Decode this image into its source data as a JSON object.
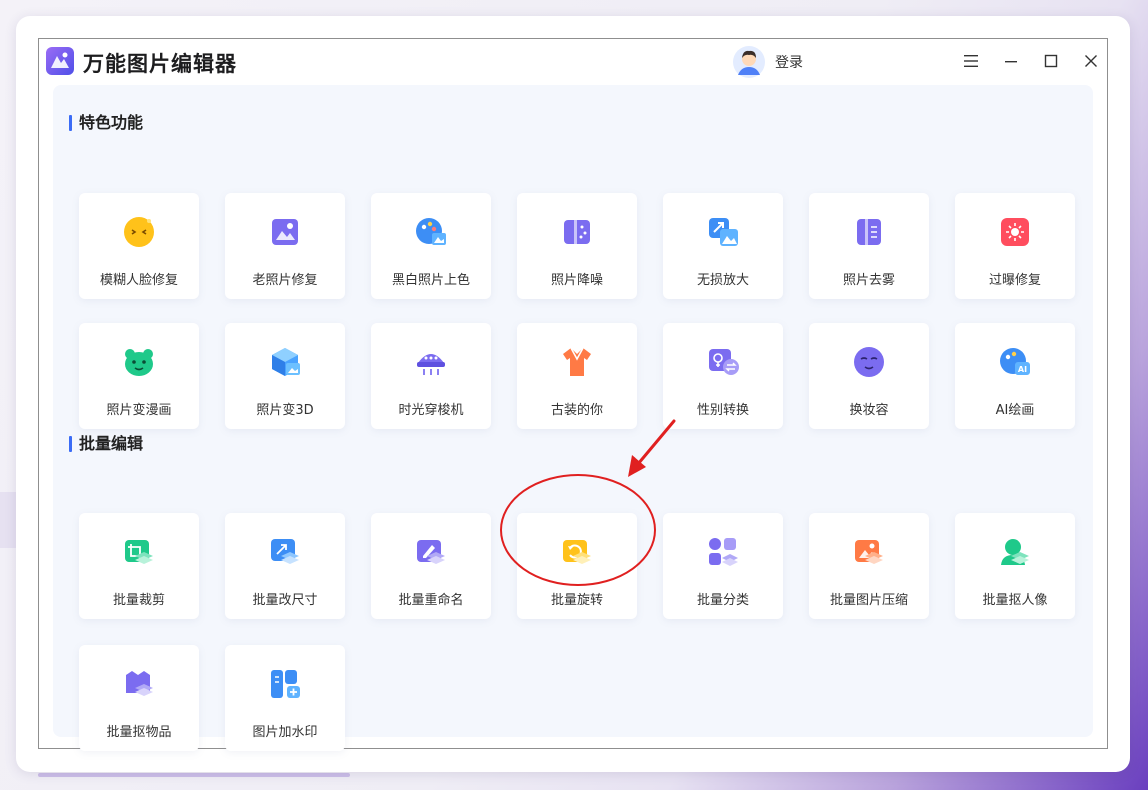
{
  "app": {
    "title": "万能图片编辑器",
    "login_label": "登录"
  },
  "sections": [
    {
      "title": "特色功能",
      "items": [
        {
          "label": "模糊人脸修复",
          "icon": "blur-face-icon"
        },
        {
          "label": "老照片修复",
          "icon": "old-photo-icon"
        },
        {
          "label": "黑白照片上色",
          "icon": "palette-icon"
        },
        {
          "label": "照片降噪",
          "icon": "denoise-icon"
        },
        {
          "label": "无损放大",
          "icon": "enlarge-icon"
        },
        {
          "label": "照片去雾",
          "icon": "dehaze-icon"
        },
        {
          "label": "过曝修复",
          "icon": "overexposure-icon"
        },
        {
          "label": "照片变漫画",
          "icon": "cartoon-icon"
        },
        {
          "label": "照片变3D",
          "icon": "cube-3d-icon"
        },
        {
          "label": "时光穿梭机",
          "icon": "time-machine-icon"
        },
        {
          "label": "古装的你",
          "icon": "costume-icon"
        },
        {
          "label": "性别转换",
          "icon": "gender-swap-icon"
        },
        {
          "label": "换妆容",
          "icon": "makeup-icon"
        },
        {
          "label": "AI绘画",
          "icon": "ai-paint-icon"
        }
      ]
    },
    {
      "title": "批量编辑",
      "items": [
        {
          "label": "批量裁剪",
          "icon": "crop-icon"
        },
        {
          "label": "批量改尺寸",
          "icon": "resize-icon"
        },
        {
          "label": "批量重命名",
          "icon": "rename-icon"
        },
        {
          "label": "批量旋转",
          "icon": "rotate-icon"
        },
        {
          "label": "批量分类",
          "icon": "classify-icon"
        },
        {
          "label": "批量图片压缩",
          "icon": "compress-icon"
        },
        {
          "label": "批量抠人像",
          "icon": "portrait-cutout-icon"
        },
        {
          "label": "批量抠物品",
          "icon": "object-cutout-icon"
        },
        {
          "label": "图片加水印",
          "icon": "watermark-icon"
        }
      ]
    }
  ],
  "colors": {
    "accent": "#3b6cf6",
    "annotation": "#e02020",
    "purple": "#7b6cf0",
    "blue": "#3d8ef5",
    "yellow": "#ffc21a",
    "green": "#1fc98a",
    "orange": "#ff7a45",
    "red": "#ff4d5e"
  }
}
